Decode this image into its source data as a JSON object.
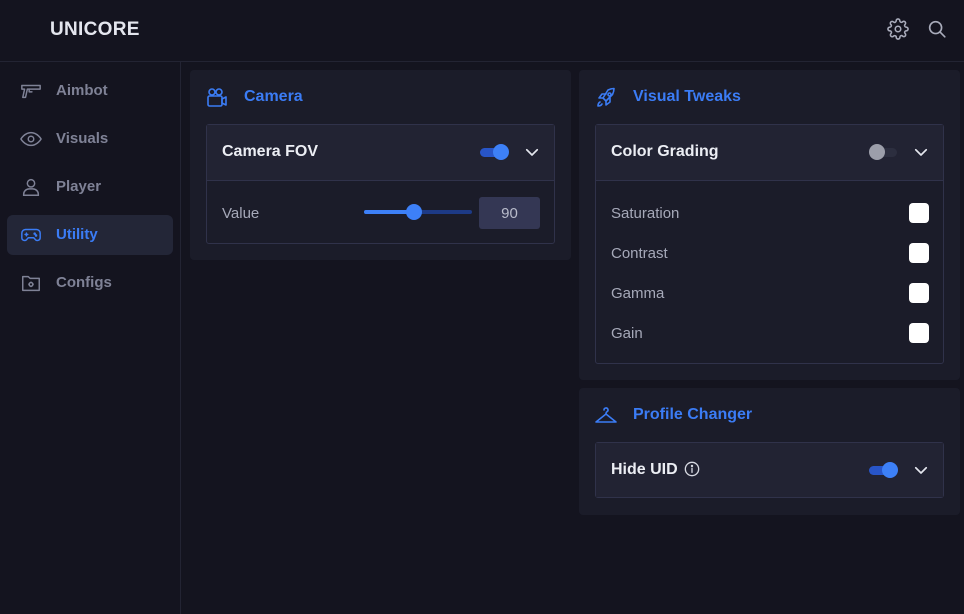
{
  "app": {
    "title": "UNICORE"
  },
  "topbar": {
    "settings_icon": "gear-icon",
    "search_icon": "search-icon"
  },
  "sidebar": {
    "items": [
      {
        "label": "Aimbot",
        "icon": "gun-icon",
        "active": false
      },
      {
        "label": "Visuals",
        "icon": "eye-icon",
        "active": false
      },
      {
        "label": "Player",
        "icon": "user-icon",
        "active": false
      },
      {
        "label": "Utility",
        "icon": "gamepad-icon",
        "active": true
      },
      {
        "label": "Configs",
        "icon": "folder-gear-icon",
        "active": false
      }
    ]
  },
  "camera_panel": {
    "title": "Camera",
    "icon": "video-camera-icon",
    "camera_fov": {
      "label": "Camera FOV",
      "enabled": true,
      "value_label": "Value",
      "value": "90",
      "slider_fraction": 0.46
    }
  },
  "visual_tweaks_panel": {
    "title": "Visual Tweaks",
    "icon": "rocket-icon",
    "color_grading": {
      "label": "Color Grading",
      "enabled": false,
      "options": [
        {
          "label": "Saturation",
          "checked": false
        },
        {
          "label": "Contrast",
          "checked": false
        },
        {
          "label": "Gamma",
          "checked": false
        },
        {
          "label": "Gain",
          "checked": false
        }
      ]
    }
  },
  "profile_changer_panel": {
    "title": "Profile Changer",
    "icon": "hanger-icon",
    "hide_uid": {
      "label": "Hide UID",
      "enabled": true,
      "info_icon": "info-icon"
    }
  },
  "colors": {
    "accent": "#3b7cf5",
    "background": "#14141f",
    "panel": "#1b1c29"
  }
}
